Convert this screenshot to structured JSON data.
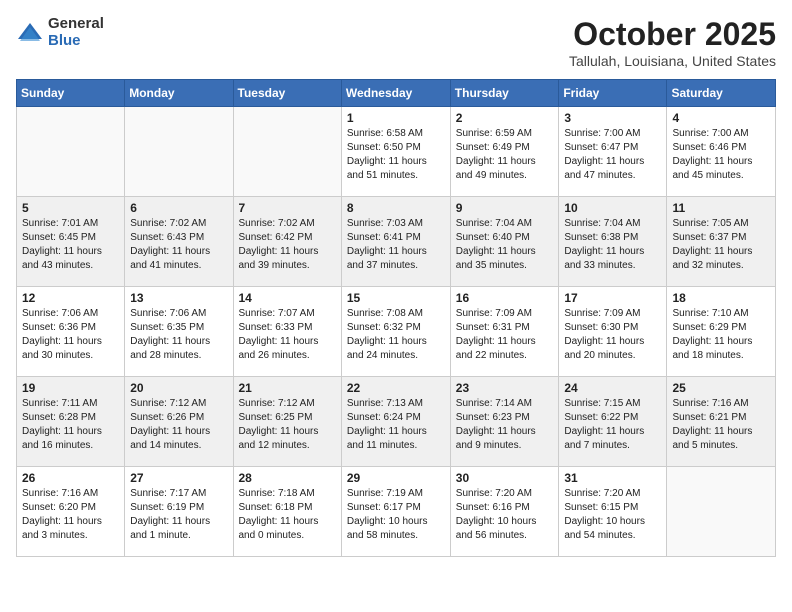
{
  "header": {
    "logo_general": "General",
    "logo_blue": "Blue",
    "month": "October 2025",
    "location": "Tallulah, Louisiana, United States"
  },
  "days_of_week": [
    "Sunday",
    "Monday",
    "Tuesday",
    "Wednesday",
    "Thursday",
    "Friday",
    "Saturday"
  ],
  "weeks": [
    [
      {
        "day": "",
        "info": ""
      },
      {
        "day": "",
        "info": ""
      },
      {
        "day": "",
        "info": ""
      },
      {
        "day": "1",
        "info": "Sunrise: 6:58 AM\nSunset: 6:50 PM\nDaylight: 11 hours\nand 51 minutes."
      },
      {
        "day": "2",
        "info": "Sunrise: 6:59 AM\nSunset: 6:49 PM\nDaylight: 11 hours\nand 49 minutes."
      },
      {
        "day": "3",
        "info": "Sunrise: 7:00 AM\nSunset: 6:47 PM\nDaylight: 11 hours\nand 47 minutes."
      },
      {
        "day": "4",
        "info": "Sunrise: 7:00 AM\nSunset: 6:46 PM\nDaylight: 11 hours\nand 45 minutes."
      }
    ],
    [
      {
        "day": "5",
        "info": "Sunrise: 7:01 AM\nSunset: 6:45 PM\nDaylight: 11 hours\nand 43 minutes."
      },
      {
        "day": "6",
        "info": "Sunrise: 7:02 AM\nSunset: 6:43 PM\nDaylight: 11 hours\nand 41 minutes."
      },
      {
        "day": "7",
        "info": "Sunrise: 7:02 AM\nSunset: 6:42 PM\nDaylight: 11 hours\nand 39 minutes."
      },
      {
        "day": "8",
        "info": "Sunrise: 7:03 AM\nSunset: 6:41 PM\nDaylight: 11 hours\nand 37 minutes."
      },
      {
        "day": "9",
        "info": "Sunrise: 7:04 AM\nSunset: 6:40 PM\nDaylight: 11 hours\nand 35 minutes."
      },
      {
        "day": "10",
        "info": "Sunrise: 7:04 AM\nSunset: 6:38 PM\nDaylight: 11 hours\nand 33 minutes."
      },
      {
        "day": "11",
        "info": "Sunrise: 7:05 AM\nSunset: 6:37 PM\nDaylight: 11 hours\nand 32 minutes."
      }
    ],
    [
      {
        "day": "12",
        "info": "Sunrise: 7:06 AM\nSunset: 6:36 PM\nDaylight: 11 hours\nand 30 minutes."
      },
      {
        "day": "13",
        "info": "Sunrise: 7:06 AM\nSunset: 6:35 PM\nDaylight: 11 hours\nand 28 minutes."
      },
      {
        "day": "14",
        "info": "Sunrise: 7:07 AM\nSunset: 6:33 PM\nDaylight: 11 hours\nand 26 minutes."
      },
      {
        "day": "15",
        "info": "Sunrise: 7:08 AM\nSunset: 6:32 PM\nDaylight: 11 hours\nand 24 minutes."
      },
      {
        "day": "16",
        "info": "Sunrise: 7:09 AM\nSunset: 6:31 PM\nDaylight: 11 hours\nand 22 minutes."
      },
      {
        "day": "17",
        "info": "Sunrise: 7:09 AM\nSunset: 6:30 PM\nDaylight: 11 hours\nand 20 minutes."
      },
      {
        "day": "18",
        "info": "Sunrise: 7:10 AM\nSunset: 6:29 PM\nDaylight: 11 hours\nand 18 minutes."
      }
    ],
    [
      {
        "day": "19",
        "info": "Sunrise: 7:11 AM\nSunset: 6:28 PM\nDaylight: 11 hours\nand 16 minutes."
      },
      {
        "day": "20",
        "info": "Sunrise: 7:12 AM\nSunset: 6:26 PM\nDaylight: 11 hours\nand 14 minutes."
      },
      {
        "day": "21",
        "info": "Sunrise: 7:12 AM\nSunset: 6:25 PM\nDaylight: 11 hours\nand 12 minutes."
      },
      {
        "day": "22",
        "info": "Sunrise: 7:13 AM\nSunset: 6:24 PM\nDaylight: 11 hours\nand 11 minutes."
      },
      {
        "day": "23",
        "info": "Sunrise: 7:14 AM\nSunset: 6:23 PM\nDaylight: 11 hours\nand 9 minutes."
      },
      {
        "day": "24",
        "info": "Sunrise: 7:15 AM\nSunset: 6:22 PM\nDaylight: 11 hours\nand 7 minutes."
      },
      {
        "day": "25",
        "info": "Sunrise: 7:16 AM\nSunset: 6:21 PM\nDaylight: 11 hours\nand 5 minutes."
      }
    ],
    [
      {
        "day": "26",
        "info": "Sunrise: 7:16 AM\nSunset: 6:20 PM\nDaylight: 11 hours\nand 3 minutes."
      },
      {
        "day": "27",
        "info": "Sunrise: 7:17 AM\nSunset: 6:19 PM\nDaylight: 11 hours\nand 1 minute."
      },
      {
        "day": "28",
        "info": "Sunrise: 7:18 AM\nSunset: 6:18 PM\nDaylight: 11 hours\nand 0 minutes."
      },
      {
        "day": "29",
        "info": "Sunrise: 7:19 AM\nSunset: 6:17 PM\nDaylight: 10 hours\nand 58 minutes."
      },
      {
        "day": "30",
        "info": "Sunrise: 7:20 AM\nSunset: 6:16 PM\nDaylight: 10 hours\nand 56 minutes."
      },
      {
        "day": "31",
        "info": "Sunrise: 7:20 AM\nSunset: 6:15 PM\nDaylight: 10 hours\nand 54 minutes."
      },
      {
        "day": "",
        "info": ""
      }
    ]
  ]
}
